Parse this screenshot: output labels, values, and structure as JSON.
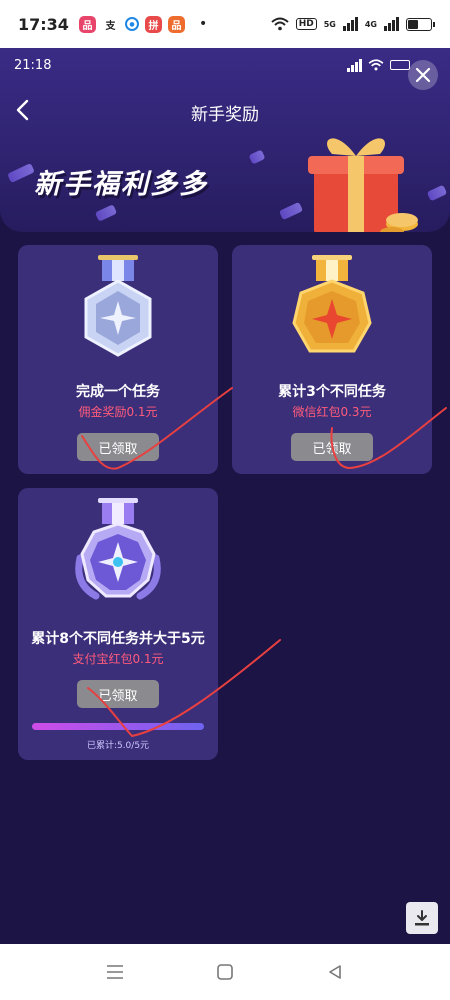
{
  "status_bar": {
    "time": "17:34",
    "app_icons": [
      {
        "name": "app-icon-1",
        "color": "#e8456a",
        "glyph": "品"
      },
      {
        "name": "app-icon-2",
        "color": "#ffffff",
        "glyph": "支"
      },
      {
        "name": "app-icon-3",
        "color": "#1e88e5",
        "glyph": "●"
      },
      {
        "name": "app-icon-4",
        "color": "#e84a4a",
        "glyph": "拼"
      },
      {
        "name": "app-icon-5",
        "color": "#ef6c2f",
        "glyph": "品"
      }
    ],
    "dot": "•",
    "hd_label": "HD",
    "signal_5g": "5G",
    "signal_4g": "4G",
    "battery_level": 0.45
  },
  "inner_status": {
    "time": "21:18"
  },
  "header": {
    "title": "新手奖励",
    "banner_text": "新手福利多多"
  },
  "tasks": [
    {
      "title": "完成一个任务",
      "reward": "佣金奖励0.1元",
      "button_label": "已领取",
      "medal": "silver"
    },
    {
      "title": "累计3个不同任务",
      "reward": "微信红包0.3元",
      "button_label": "已领取",
      "medal": "gold"
    },
    {
      "title": "累计8个不同任务并大于5元",
      "reward": "支付宝红包0.1元",
      "button_label": "已领取",
      "medal": "purple",
      "progress": {
        "label": "已累计:5.0/5元",
        "fraction": 1.0
      }
    }
  ],
  "colors": {
    "background": "#1c1444",
    "card": "#3b2f7a",
    "reward_text": "#ff5b7a",
    "claimed_button": "#8a8a8f"
  }
}
